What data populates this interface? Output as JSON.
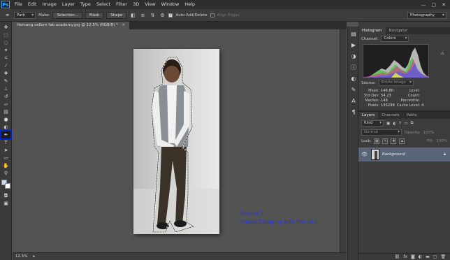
{
  "app": {
    "logo": "Ps",
    "menus": [
      "File",
      "Edit",
      "Image",
      "Layer",
      "Type",
      "Select",
      "Filter",
      "3D",
      "View",
      "Window",
      "Help"
    ],
    "window_controls": [
      "—",
      "▢",
      "✕"
    ]
  },
  "options": {
    "mode_value": "Path",
    "make_label": "Make:",
    "selection_label": "Selection...",
    "mask_label": "Mask",
    "shape_label": "Shape",
    "auto_add_delete_label": "Auto Add/Delete",
    "align_edges_label": "Align Edges",
    "workspace_value": "Photography"
  },
  "document": {
    "tab_title": "Hemang vellore fab academy.jpg @ 12.5% (RGB/8) *",
    "tab_close": "×",
    "zoom": "12.5%",
    "canvas_text_line1": "Screen 2",
    "canvas_text_line2": "Image Cropping with Pen tool"
  },
  "histogram_panel": {
    "tabs": [
      "Histogram",
      "Navigator"
    ],
    "channel_label": "Channel:",
    "channel_value": "Colors",
    "source_label": "Source:",
    "source_value": "Entire Image",
    "stats": [
      {
        "label": "Mean:",
        "value": "146.80",
        "label2": "Level:",
        "value2": ""
      },
      {
        "label": "Std Dev:",
        "value": "54.23",
        "label2": "Count:",
        "value2": ""
      },
      {
        "label": "Median:",
        "value": "146",
        "label2": "Percentile:",
        "value2": ""
      },
      {
        "label": "Pixels:",
        "value": "135298",
        "label2": "Cache Level:",
        "value2": "4"
      }
    ]
  },
  "layers_panel": {
    "tabs": [
      "Layers",
      "Channels",
      "Paths"
    ],
    "filter_value": "Kind",
    "blend_value": "Normal",
    "opacity_label": "Opacity:",
    "opacity_value": "100%",
    "lock_label": "Lock:",
    "fill_label": "Fill:",
    "fill_value": "100%",
    "layers": [
      {
        "name": "Background"
      }
    ],
    "footer_icons": [
      "link-icon",
      "fx-icon",
      "mask-icon",
      "adjustment-icon",
      "folder-icon",
      "new-layer-icon",
      "trash-icon"
    ]
  },
  "colors": {
    "canvas_text": "#2233ee",
    "active_tool_outline": "#0022cc",
    "selected_layer": "#596477"
  }
}
